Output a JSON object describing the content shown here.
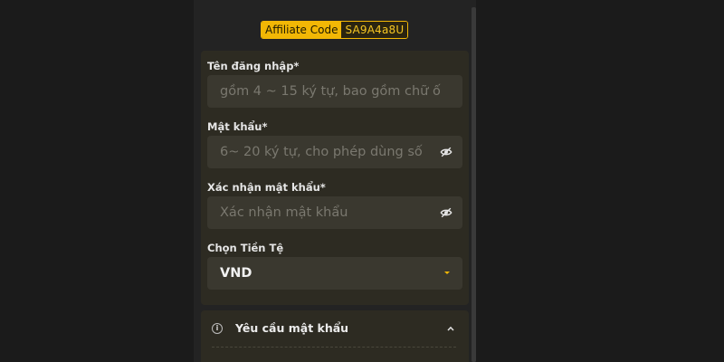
{
  "affiliate": {
    "label": "Affiliate Code",
    "code": "SA9A4a8U"
  },
  "form": {
    "username": {
      "label": "Tên đăng nhập*",
      "placeholder": "gồm 4 ~ 15 ký tự, bao gồm chữ ố"
    },
    "password": {
      "label": "Mật khẩu*",
      "placeholder": "6~ 20 ký tự, cho phép dùng số",
      "icon": "eye-slash-icon"
    },
    "confirm_password": {
      "label": "Xác nhận mật khẩu*",
      "placeholder": "Xác nhận mật khẩu",
      "icon": "eye-slash-icon"
    },
    "currency": {
      "label": "Chọn Tiền Tệ",
      "value": "VND",
      "icon": "caret-down-icon"
    }
  },
  "requirements": {
    "title": "Yêu cầu mật khẩu",
    "icon": "info-icon",
    "toggle_icon": "chevron-up-icon"
  },
  "colors": {
    "accent": "#f2b705",
    "background": "#1b1b1b",
    "card": "#2d2b22",
    "input": "#3a382f"
  }
}
